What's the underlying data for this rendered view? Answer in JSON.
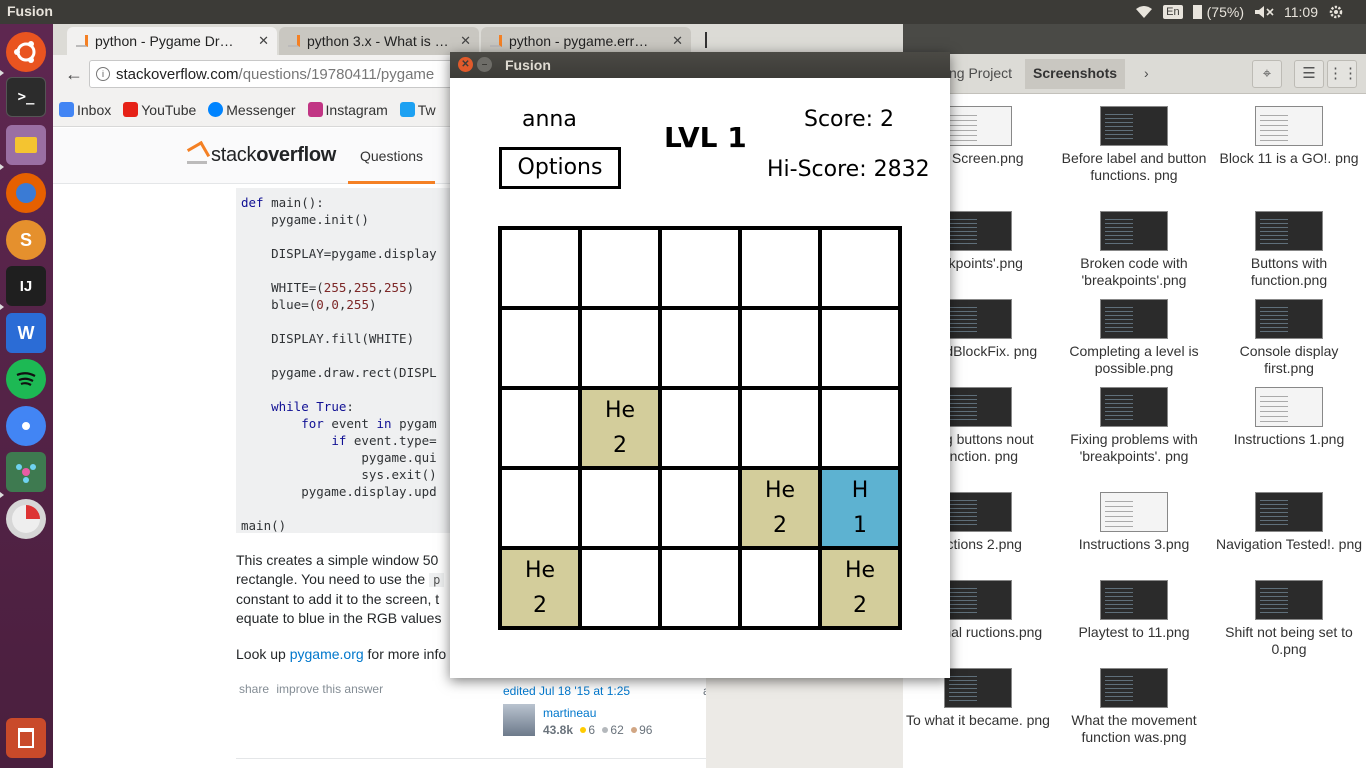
{
  "topbar": {
    "app_name": "Fusion",
    "lang": "En",
    "battery": "(75%)",
    "time": "11:09"
  },
  "launcher": {
    "items": [
      {
        "name": "Ubuntu Dash",
        "icon": "ubuntu-icon",
        "color": "#e95420"
      },
      {
        "name": "Terminal",
        "icon": "terminal-icon",
        "color": "#2c2c2c"
      },
      {
        "name": "Files",
        "icon": "folder-icon",
        "color": "#9a6fa3"
      },
      {
        "name": "Firefox",
        "icon": "firefox-icon",
        "color": "#e66000"
      },
      {
        "name": "Sublime",
        "icon": "s-icon",
        "color": "#e5902d"
      },
      {
        "name": "IntelliJ",
        "icon": "intellij-icon",
        "color": "#1f1f1f"
      },
      {
        "name": "WPS Writer",
        "icon": "w-icon",
        "color": "#2b6cd6"
      },
      {
        "name": "Spotify",
        "icon": "spotify-icon",
        "color": "#1db954"
      },
      {
        "name": "Chrome",
        "icon": "chrome-icon",
        "color": "#4285f4"
      },
      {
        "name": "Fusion",
        "icon": "fusion-icon",
        "color": "#3e7a50"
      },
      {
        "name": "Disks",
        "icon": "disk-icon",
        "color": "#d7d7d7"
      },
      {
        "name": "Trash",
        "icon": "trash-icon",
        "color": "#c94a2a"
      }
    ]
  },
  "browser": {
    "tabs": [
      {
        "label": "python - Pygame Dr…",
        "active": true
      },
      {
        "label": "python 3.x - What is …",
        "active": false
      },
      {
        "label": "python - pygame.err…",
        "active": false
      }
    ],
    "url_host": "stackoverflow.com",
    "url_path": "/questions/19780411/pygame",
    "bookmarks": [
      "Inbox",
      "YouTube",
      "Messenger",
      "Instagram",
      "Tw"
    ],
    "so": {
      "logo_a": "stack",
      "logo_b": "overflow",
      "nav_questions": "Questions",
      "code_lines": [
        {
          "t": "def main():",
          "kw": "def"
        },
        {
          "t": "    pygame.init()"
        },
        {
          "t": ""
        },
        {
          "t": "    DISPLAY=pygame.display"
        },
        {
          "t": ""
        },
        {
          "t": "    WHITE=(255,255,255)",
          "num": true
        },
        {
          "t": "    blue=(0,0,255)",
          "num": true
        },
        {
          "t": ""
        },
        {
          "t": "    DISPLAY.fill(WHITE)"
        },
        {
          "t": ""
        },
        {
          "t": "    pygame.draw.rect(DISPL"
        },
        {
          "t": ""
        },
        {
          "t": "    while True:",
          "kw": "while True"
        },
        {
          "t": "        for event in pygam",
          "kw": "for"
        },
        {
          "t": "            if event.type=",
          "kw": "if"
        },
        {
          "t": "                pygame.qui"
        },
        {
          "t": "                sys.exit()"
        },
        {
          "t": "        pygame.display.upd"
        },
        {
          "t": ""
        },
        {
          "t": "main()"
        }
      ],
      "answer_lines": [
        "This creates a simple window 50",
        "rectangle. You need to use the",
        "constant to add it to the screen, t",
        "equate to blue in the RGB values"
      ],
      "inline_code": "p",
      "lookup_pre": "Look up ",
      "lookup_link": "pygame.org",
      "lookup_post": " for more info",
      "share": "share",
      "improve": "improve this answer",
      "edited": "edited Jul 18 '15 at 1:25",
      "user_name": "martineau",
      "user_rep": "43.8k",
      "gold": "6",
      "silver": "62",
      "bronze": "96",
      "stray_char": "a"
    }
  },
  "files": {
    "crumbs": [
      "ng Project",
      "Screenshots"
    ],
    "items": [
      {
        "label": "na Screen.png",
        "light": true
      },
      {
        "label": "Before label and button functions. png"
      },
      {
        "label": "Block 11 is a GO!. png",
        "light": true
      },
      {
        "label": "eakpoints'.png"
      },
      {
        "label": "Broken code with 'breakpoints'.png"
      },
      {
        "label": "Buttons with function.png"
      },
      {
        "label": "binedBlockFix. png"
      },
      {
        "label": "Completing a level is possible.png"
      },
      {
        "label": "Console display first.png"
      },
      {
        "label": "ating buttons nout function. png"
      },
      {
        "label": "Fixing problems with 'breakpoints'. png"
      },
      {
        "label": "Instructions 1.png",
        "light": true
      },
      {
        "label": "ructions 2.png"
      },
      {
        "label": "Instructions 3.png",
        "light": true
      },
      {
        "label": "Navigation Tested!. png"
      },
      {
        "label": "Original ructions.png"
      },
      {
        "label": "Playtest to 11.png"
      },
      {
        "label": "Shift not being set to 0.png"
      },
      {
        "label": "To what it became. png"
      },
      {
        "label": "What the movement function was.png"
      }
    ]
  },
  "fusion": {
    "window_title": "Fusion",
    "player": "anna",
    "level": "LVL 1",
    "score": "Score: 2",
    "hiscore": "Hi-Score: 2832",
    "options": "Options",
    "tile_colors": {
      "He": "#d3cd9b",
      "H": "#5db2d1",
      "empty": "#ffffff"
    },
    "grid": [
      [
        null,
        null,
        null,
        null,
        null
      ],
      [
        null,
        null,
        null,
        null,
        null
      ],
      [
        null,
        {
          "el": "He",
          "n": "2"
        },
        null,
        null,
        null
      ],
      [
        null,
        null,
        null,
        {
          "el": "He",
          "n": "2"
        },
        {
          "el": "H",
          "n": "1"
        }
      ],
      [
        {
          "el": "He",
          "n": "2"
        },
        null,
        null,
        null,
        {
          "el": "He",
          "n": "2"
        }
      ]
    ]
  }
}
